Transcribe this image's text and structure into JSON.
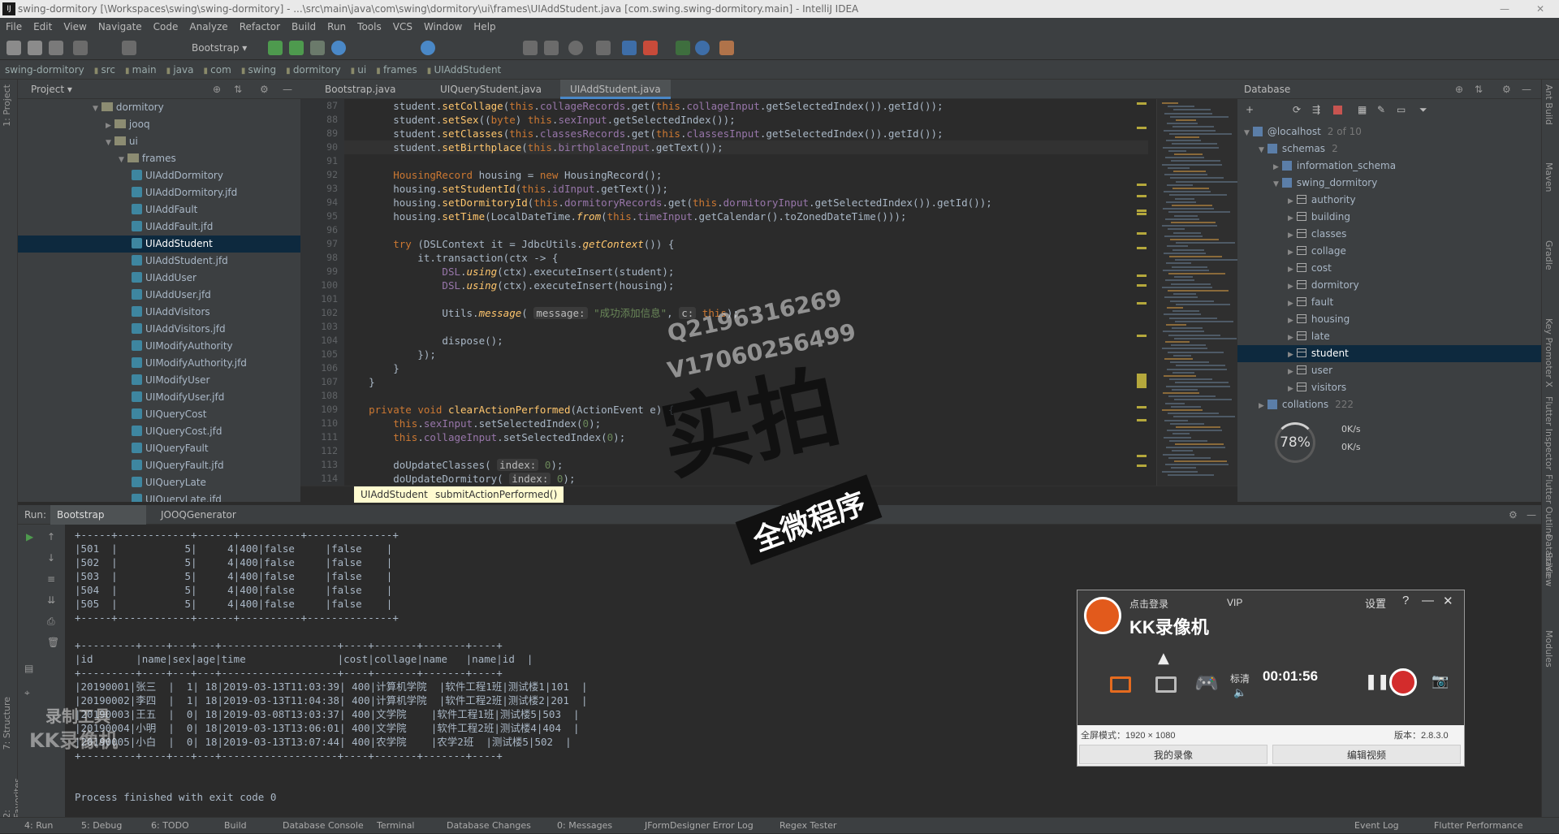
{
  "window": {
    "title": "swing-dormitory [\\Workspaces\\swing\\swing-dormitory] - ...\\src\\main\\java\\com\\swing\\dormitory\\ui\\frames\\UIAddStudent.java [com.swing.swing-dormitory.main] - IntelliJ IDEA"
  },
  "menu": [
    "File",
    "Edit",
    "View",
    "Navigate",
    "Code",
    "Analyze",
    "Refactor",
    "Build",
    "Run",
    "Tools",
    "VCS",
    "Window",
    "Help"
  ],
  "toolbar": {
    "run_config": "Bootstrap"
  },
  "breadcrumbs": [
    "swing-dormitory",
    "src",
    "main",
    "java",
    "com",
    "swing",
    "dormitory",
    "ui",
    "frames",
    "UIAddStudent"
  ],
  "project": {
    "header": "Project",
    "side_label": "1: Project",
    "tree": [
      {
        "label": "dormitory",
        "type": "folder",
        "open": true
      },
      {
        "label": "jooq",
        "type": "folder",
        "open": false
      },
      {
        "label": "ui",
        "type": "folder",
        "open": true
      },
      {
        "label": "frames",
        "type": "folder",
        "open": true
      },
      {
        "label": "UIAddDormitory",
        "type": "class"
      },
      {
        "label": "UIAddDormitory.jfd",
        "type": "class"
      },
      {
        "label": "UIAddFault",
        "type": "class"
      },
      {
        "label": "UIAddFault.jfd",
        "type": "class"
      },
      {
        "label": "UIAddStudent",
        "type": "class",
        "selected": true
      },
      {
        "label": "UIAddStudent.jfd",
        "type": "class"
      },
      {
        "label": "UIAddUser",
        "type": "class"
      },
      {
        "label": "UIAddUser.jfd",
        "type": "class"
      },
      {
        "label": "UIAddVisitors",
        "type": "class"
      },
      {
        "label": "UIAddVisitors.jfd",
        "type": "class"
      },
      {
        "label": "UIModifyAuthority",
        "type": "class"
      },
      {
        "label": "UIModifyAuthority.jfd",
        "type": "class"
      },
      {
        "label": "UIModifyUser",
        "type": "class"
      },
      {
        "label": "UIModifyUser.jfd",
        "type": "class"
      },
      {
        "label": "UIQueryCost",
        "type": "class"
      },
      {
        "label": "UIQueryCost.jfd",
        "type": "class"
      },
      {
        "label": "UIQueryFault",
        "type": "class"
      },
      {
        "label": "UIQueryFault.jfd",
        "type": "class"
      },
      {
        "label": "UIQueryLate",
        "type": "class"
      },
      {
        "label": "UIQueryLate.jfd",
        "type": "class"
      }
    ]
  },
  "editor": {
    "tabs": [
      "Bootstrap.java",
      "UIQueryStudent.java",
      "UIAddStudent.java"
    ],
    "active_tab": 2,
    "lines": [
      {
        "n": "87",
        "h": "        student.<f>setCollage</f>(<k>this</k>.<m>collageRecords</m>.get(<k>this</k>.<m>collageInput</m>.getSelectedIndex()).getId());"
      },
      {
        "n": "88",
        "h": "        student.<f>setSex</f>((<k>byte</k>) <k>this</k>.<m>sexInput</m>.getSelectedIndex());"
      },
      {
        "n": "89",
        "h": "        student.<f>setClasses</f>(<k>this</k>.<m>classesRecords</m>.get(<k>this</k>.<m>classesInput</m>.getSelectedIndex()).getId());"
      },
      {
        "n": "90",
        "h": "        student.<f>setBirthplace</f>(<k>this</k>.<m>birthplaceInput</m>.getText());",
        "curr": true
      },
      {
        "n": "91",
        "h": ""
      },
      {
        "n": "92",
        "h": "        <k>HousingRecord</k> housing = <k>new</k> HousingRecord();"
      },
      {
        "n": "93",
        "h": "        housing.<f>setStudentId</f>(<k>this</k>.<m>idInput</m>.getText());"
      },
      {
        "n": "94",
        "h": "        housing.<f>setDormitoryId</f>(<k>this</k>.<m>dormitoryRecords</m>.get(<k>this</k>.<m>dormitoryInput</m>.getSelectedIndex()).getId());"
      },
      {
        "n": "95",
        "h": "        housing.<f>setTime</f>(LocalDateTime.<st>from</st>(<k>this</k>.<m>timeInput</m>.getCalendar().toZonedDateTime()));"
      },
      {
        "n": "96",
        "h": ""
      },
      {
        "n": "97",
        "h": "        <k>try</k> (DSLContext it = JdbcUtils.<st>getContext</st>()) {"
      },
      {
        "n": "98",
        "h": "            it.transaction(ctx -> {"
      },
      {
        "n": "99",
        "h": "                <m>DSL</m>.<st>using</st>(ctx).executeInsert(student);"
      },
      {
        "n": "100",
        "h": "                <m>DSL</m>.<st>using</st>(ctx).executeInsert(housing);"
      },
      {
        "n": "101",
        "h": ""
      },
      {
        "n": "102",
        "h": "                Utils.<st>message</st>( <t>message:</t> <s>\"成功添加信息\"</s>, <t>c:</t> <k>this</k>);"
      },
      {
        "n": "103",
        "h": ""
      },
      {
        "n": "104",
        "h": "                dispose();"
      },
      {
        "n": "105",
        "h": "            });"
      },
      {
        "n": "106",
        "h": "        }"
      },
      {
        "n": "107",
        "h": "    }"
      },
      {
        "n": "108",
        "h": ""
      },
      {
        "n": "109",
        "h": "    <k>private void</k> <f>clearActionPerformed</f>(ActionEvent e) {"
      },
      {
        "n": "110",
        "h": "        <k>this</k>.<m>sexInput</m>.setSelectedIndex(<s>0</s>);"
      },
      {
        "n": "111",
        "h": "        <k>this</k>.<m>collageInput</m>.setSelectedIndex(<s>0</s>);"
      },
      {
        "n": "112",
        "h": ""
      },
      {
        "n": "113",
        "h": "        doUpdateClasses( <t>index:</t> <s>0</s>);"
      },
      {
        "n": "114",
        "h": "        doUpdateDormitory( <t>index:</t> <s>0</s>);"
      }
    ],
    "crumb_class": "UIAddStudent",
    "crumb_method": "submitActionPerformed()"
  },
  "database": {
    "header": "Database",
    "side_label": "Database",
    "tree": [
      {
        "label": "@localhost",
        "extra": "2 of 10",
        "indent": 0,
        "type": "host"
      },
      {
        "label": "schemas",
        "extra": "2",
        "indent": 1,
        "type": "folder"
      },
      {
        "label": "information_schema",
        "indent": 2,
        "type": "schema"
      },
      {
        "label": "swing_dormitory",
        "indent": 2,
        "type": "schema"
      },
      {
        "label": "authority",
        "indent": 3,
        "type": "table"
      },
      {
        "label": "building",
        "indent": 3,
        "type": "table"
      },
      {
        "label": "classes",
        "indent": 3,
        "type": "table"
      },
      {
        "label": "collage",
        "indent": 3,
        "type": "table"
      },
      {
        "label": "cost",
        "indent": 3,
        "type": "table"
      },
      {
        "label": "dormitory",
        "indent": 3,
        "type": "table"
      },
      {
        "label": "fault",
        "indent": 3,
        "type": "table"
      },
      {
        "label": "housing",
        "indent": 3,
        "type": "table"
      },
      {
        "label": "late",
        "indent": 3,
        "type": "table"
      },
      {
        "label": "student",
        "indent": 3,
        "type": "table",
        "selected": true
      },
      {
        "label": "user",
        "indent": 3,
        "type": "table"
      },
      {
        "label": "visitors",
        "indent": 3,
        "type": "table"
      },
      {
        "label": "collations",
        "extra": "222",
        "indent": 1,
        "type": "folder"
      }
    ],
    "gauge": "78%",
    "net_up": "0K/s",
    "net_down": "0K/s"
  },
  "run": {
    "label": "Run:",
    "tab1": "Bootstrap",
    "tab2": "JOOQGenerator",
    "console": [
      "+-----+------------+------+----------+--------------+",
      "|501  |           5|     4|400|false     |false    |",
      "|502  |           5|     4|400|false     |false    |",
      "|503  |           5|     4|400|false     |false    |",
      "|504  |           5|     4|400|false     |false    |",
      "|505  |           5|     4|400|false     |false    |",
      "+-----+------------+------+----------+--------------+",
      "",
      "+---------+----+---+---+-------------------+----+-------+-------+----+",
      "|id       |name|sex|age|time               |cost|collage|name   |name|id  |",
      "+---------+----+---+---+-------------------+----+-------+-------+----+",
      "|20190001|张三  |  1| 18|2019-03-13T11:03:39| 400|计算机学院  |软件工程1班|测试楼1|101  |",
      "|20190002|李四  |  1| 18|2019-03-13T11:04:38| 400|计算机学院  |软件工程2班|测试楼2|201  |",
      "|20190003|王五  |  0| 18|2019-03-08T13:03:37| 400|文学院    |软件工程1班|测试楼5|503  |",
      "|20190004|小明  |  0| 18|2019-03-13T13:06:01| 400|文学院    |软件工程2班|测试楼4|404  |",
      "|20190005|小白  |  0| 18|2019-03-13T13:07:44| 400|农学院    |农学2班  |测试楼5|502  |",
      "+---------+----+---+---+-------------------+----+-------+-------+----+",
      "",
      "",
      "Process finished with exit code 0"
    ]
  },
  "statusbar": [
    "4: Run",
    "5: Debug",
    "6: TODO",
    "Build",
    "Database Console",
    "Terminal",
    "Database Changes",
    "0: Messages",
    "JFormDesigner Error Log",
    "Regex Tester",
    "Event Log",
    "Flutter Performance"
  ],
  "side_tools_left": [
    "2: Favorites",
    "7: Structure"
  ],
  "side_tools_right": [
    "Ant Build",
    "Maven",
    "Gradle",
    "Key Promoter X",
    "Flutter Inspector",
    "Flutter Outline",
    "SciView",
    "Modules"
  ],
  "recorder": {
    "login": "点击登录",
    "vip": "VIP",
    "settings": "设置",
    "help": "?",
    "app": "KK录像机",
    "timer": "00:01:56",
    "quality": "标清",
    "fullscreen": "全屏模式：1920 × 1080",
    "version": "版本：2.8.3.0",
    "my_videos": "我的录像",
    "edit_video": "编辑视频"
  },
  "watermark": {
    "line1": "Q2196316269",
    "line2": "V17060256499",
    "big": "实拍",
    "stamp": "全微程序",
    "corner1": "录制工具",
    "corner2": "KK录像机"
  }
}
